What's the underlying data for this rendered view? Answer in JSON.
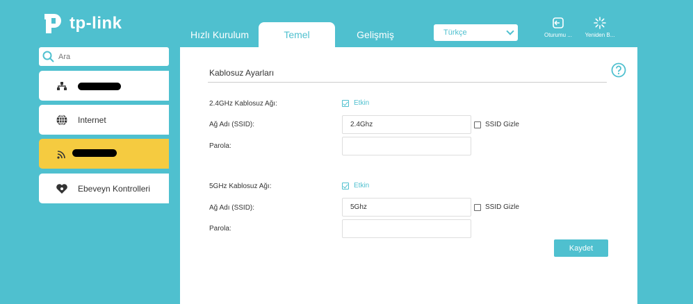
{
  "brand": {
    "name": "tp-link",
    "color": "#4fc0cf",
    "highlight": "#f5cb40"
  },
  "tabs": [
    {
      "label": "Hızlı Kurulum",
      "active": false
    },
    {
      "label": "Temel",
      "active": true
    },
    {
      "label": "Gelişmiş",
      "active": false
    }
  ],
  "language": {
    "selected": "Türkçe"
  },
  "top_buttons": [
    {
      "label": "Oturumu ...",
      "icon": "logout-icon"
    },
    {
      "label": "Yeniden B...",
      "icon": "reboot-icon"
    }
  ],
  "search": {
    "placeholder": "Ara",
    "icon": "search-icon"
  },
  "sidebar": {
    "items": [
      {
        "label": "",
        "icon": "network-map-icon",
        "redacted": true,
        "active": false
      },
      {
        "label": "Internet",
        "icon": "globe-icon",
        "redacted": false,
        "active": false
      },
      {
        "label": "",
        "icon": "wireless-icon",
        "redacted": true,
        "active": true
      },
      {
        "label": "Ebeveyn Kontrolleri",
        "icon": "parental-heart-icon",
        "redacted": false,
        "active": false
      }
    ]
  },
  "main": {
    "title": "Kablosuz Ayarları",
    "help_icon": "help-icon",
    "band24": {
      "label": "2.4GHz Kablosuz Ağı:",
      "enable_label": "Etkin",
      "enabled": true,
      "ssid_label": "Ağ Adı (SSID):",
      "ssid_value": "2.4Ghz",
      "hide_label": "SSID Gizle",
      "hide_checked": false,
      "password_label": "Parola:",
      "password_value": ""
    },
    "band5": {
      "label": "5GHz Kablosuz Ağı:",
      "enable_label": "Etkin",
      "enabled": true,
      "ssid_label": "Ağ Adı (SSID):",
      "ssid_value": "5Ghz",
      "hide_label": "SSID Gizle",
      "hide_checked": false,
      "password_label": "Parola:",
      "password_value": ""
    },
    "save_label": "Kaydet"
  }
}
